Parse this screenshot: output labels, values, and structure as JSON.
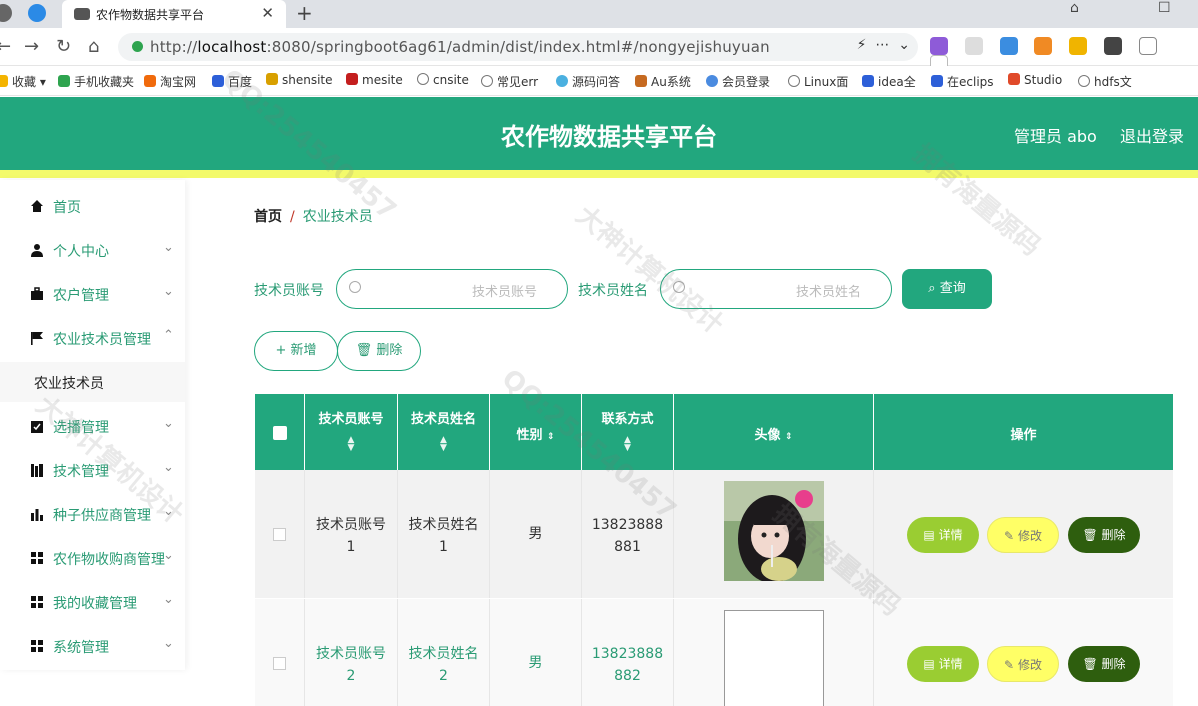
{
  "browser": {
    "tab_title": "农作物数据共享平台",
    "url_scheme": "http://",
    "url_host": "localhost",
    "url_path": ":8080/springboot6ag61/admin/dist/index.html#/nongyejishuyuan",
    "bookmarks": [
      "收藏",
      "手机收藏夹",
      "淘宝网",
      "百度",
      "shensite",
      "mesite",
      "cnsite",
      "常见err",
      "源码问答",
      "Au系统",
      "会员登录",
      "Linux面",
      "idea全",
      "在eclips",
      "Studio",
      "hdfs文"
    ]
  },
  "header": {
    "title": "农作物数据共享平台",
    "user": "管理员 abo",
    "logout": "退出登录",
    "color": "#22a77e"
  },
  "sidebar": {
    "items": [
      {
        "label": "首页",
        "icon": "home-icon"
      },
      {
        "label": "个人中心",
        "icon": "user-icon"
      },
      {
        "label": "农户管理",
        "icon": "briefcase-icon"
      },
      {
        "label": "农业技术员管理",
        "icon": "flag-icon"
      },
      {
        "label": "选播管理",
        "icon": "clipboard-icon"
      },
      {
        "label": "技术管理",
        "icon": "books-icon"
      },
      {
        "label": "种子供应商管理",
        "icon": "bar-chart-icon"
      },
      {
        "label": "农作物收购商管理",
        "icon": "grid-icon"
      },
      {
        "label": "我的收藏管理",
        "icon": "grid-icon"
      },
      {
        "label": "系统管理",
        "icon": "grid-icon"
      }
    ],
    "sub_item": "农业技术员"
  },
  "breadcrumb": {
    "home": "首页",
    "sep": "/",
    "current": "农业技术员"
  },
  "search": {
    "account_label": "技术员账号",
    "account_placeholder": "技术员账号",
    "name_label": "技术员姓名",
    "name_placeholder": "技术员姓名",
    "query_button": "查询"
  },
  "actions": {
    "add": "新增",
    "delete": "删除"
  },
  "table": {
    "headers": [
      "技术员账号",
      "技术员姓名",
      "性别",
      "联系方式",
      "头像",
      "操作"
    ],
    "rows": [
      {
        "account": "技术员账号1",
        "name": "技术员姓名1",
        "gender": "男",
        "phone": "13823888881"
      },
      {
        "account": "技术员账号2",
        "name": "技术员姓名2",
        "gender": "男",
        "phone": "13823888882"
      }
    ],
    "op_labels": {
      "detail": "详情",
      "edit": "修改",
      "delete": "删除"
    }
  },
  "watermarks": [
    "QQ:254540457",
    "大神计算机设计",
    "拥有海量源码"
  ]
}
